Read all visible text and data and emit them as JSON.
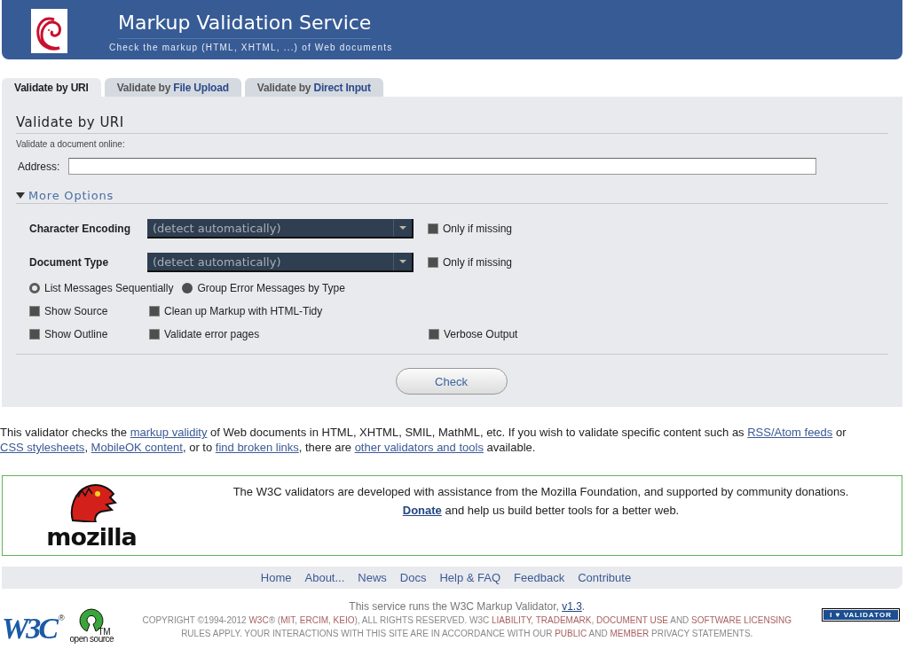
{
  "header": {
    "title": "Markup Validation Service",
    "subtitle": "Check the markup (HTML, XHTML, ...) of Web documents"
  },
  "tabs": [
    {
      "prefix": "Validate by ",
      "label": "URI",
      "selected": true
    },
    {
      "prefix": "Validate by ",
      "label": "File Upload",
      "selected": false
    },
    {
      "prefix": "Validate by ",
      "label": "Direct Input",
      "selected": false
    }
  ],
  "form": {
    "heading": "Validate by URI",
    "intro": "Validate a document online:",
    "address": {
      "label": "Address:"
    },
    "more_options": {
      "label": "More Options",
      "expanded": true
    },
    "selects": [
      {
        "label": "Character Encoding",
        "value": "(detect automatically)",
        "option": {
          "label": "Only if missing",
          "checked": false
        }
      },
      {
        "label": "Document Type",
        "value": "(detect automatically)",
        "option": {
          "label": "Only if missing",
          "checked": false
        }
      }
    ],
    "radios": [
      {
        "label": "List Messages Sequentially",
        "selected": true
      },
      {
        "label": "Group Error Messages by Type",
        "selected": false
      }
    ],
    "checkbox_rows": [
      [
        {
          "label": "Show Source",
          "checked": false
        },
        {
          "label": "Clean up Markup with HTML-Tidy",
          "checked": false
        }
      ],
      [
        {
          "label": "Show Outline",
          "checked": false
        },
        {
          "label": "Validate error pages",
          "checked": false
        },
        {
          "label": "Verbose Output",
          "checked": false
        }
      ]
    ],
    "submit": "Check"
  },
  "about": [
    {
      "kind": "text",
      "text": "This validator checks the "
    },
    {
      "kind": "link",
      "text": "markup validity"
    },
    {
      "kind": "text",
      "text": " of Web documents in HTML, XHTML, SMIL, MathML, etc. If you wish to validate specific content such as "
    },
    {
      "kind": "link",
      "text": "RSS/Atom feeds"
    },
    {
      "kind": "text",
      "text": " or "
    },
    {
      "kind": "link",
      "text": "CSS stylesheets"
    },
    {
      "kind": "text",
      "text": ", "
    },
    {
      "kind": "link",
      "text": "MobileOK content"
    },
    {
      "kind": "text",
      "text": ", or to "
    },
    {
      "kind": "link",
      "text": "find broken links"
    },
    {
      "kind": "text",
      "text": ", there are "
    },
    {
      "kind": "link",
      "text": "other validators and tools"
    },
    {
      "kind": "text",
      "text": " available."
    }
  ],
  "sponsor": {
    "logo_text": "mozilla",
    "lines": [
      [
        {
          "kind": "text",
          "text": "The W3C validators are developed with assistance from the Mozilla Foundation, and supported by community donations."
        }
      ],
      [
        {
          "kind": "link",
          "text": "Donate"
        },
        {
          "kind": "text",
          "text": " and help us build better tools for a better web."
        }
      ]
    ]
  },
  "footer": {
    "nav": [
      "Home",
      "About...",
      "News",
      "Docs",
      "Help & FAQ",
      "Feedback",
      "Contribute"
    ],
    "version": [
      {
        "kind": "text",
        "text": "This service runs the W3C Markup Validator, "
      },
      {
        "kind": "link",
        "text": "v1.3"
      },
      {
        "kind": "text",
        "text": "."
      }
    ],
    "copyright": [
      {
        "kind": "text",
        "text": "COPYRIGHT ©1994-2012 "
      },
      {
        "kind": "link",
        "text": "W3C"
      },
      {
        "kind": "text",
        "text": "® ("
      },
      {
        "kind": "link",
        "text": "MIT"
      },
      {
        "kind": "text",
        "text": ", "
      },
      {
        "kind": "link",
        "text": "ERCIM"
      },
      {
        "kind": "text",
        "text": ", "
      },
      {
        "kind": "link",
        "text": "KEIO"
      },
      {
        "kind": "text",
        "text": "), ALL RIGHTS RESERVED. W3C "
      },
      {
        "kind": "link",
        "text": "LIABILITY"
      },
      {
        "kind": "text",
        "text": ", "
      },
      {
        "kind": "link",
        "text": "TRADEMARK"
      },
      {
        "kind": "text",
        "text": ", "
      },
      {
        "kind": "link",
        "text": "DOCUMENT USE"
      },
      {
        "kind": "text",
        "text": " AND "
      },
      {
        "kind": "link",
        "text": "SOFTWARE LICENSING"
      },
      {
        "kind": "text",
        "text": " RULES APPLY. YOUR INTERACTIONS WITH THIS SITE ARE IN ACCORDANCE WITH OUR "
      },
      {
        "kind": "link",
        "text": "PUBLIC"
      },
      {
        "kind": "text",
        "text": " AND "
      },
      {
        "kind": "link",
        "text": "MEMBER"
      },
      {
        "kind": "text",
        "text": " PRIVACY STATEMENTS."
      }
    ],
    "w3c_logo": {
      "text": "W3C",
      "mark": "®"
    },
    "open_source_logo": {
      "text": "open source",
      "mark": "TM"
    },
    "badge": "I ♥ VALIDATOR"
  }
}
